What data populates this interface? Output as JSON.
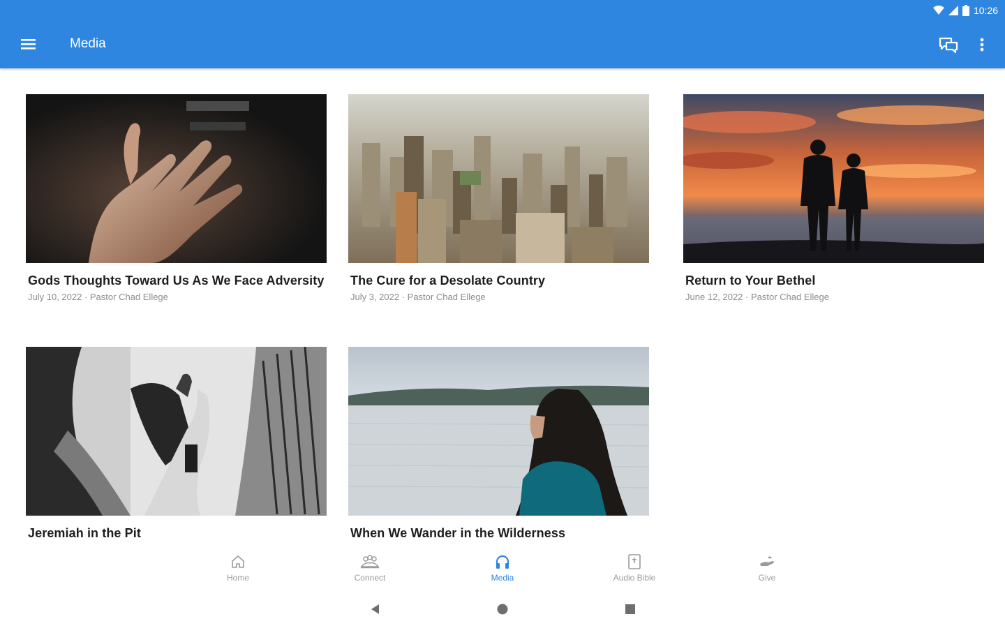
{
  "status": {
    "time": "10:26"
  },
  "appbar": {
    "title": "Media",
    "icons": {
      "menu": "menu-icon",
      "chat": "chat-icon",
      "more": "more-vert-icon"
    }
  },
  "colors": {
    "primary": "#2f86e0",
    "title_text": "#1d1d1d",
    "meta_text": "#8c8c8c"
  },
  "media": {
    "items": [
      {
        "title": "Gods Thoughts Toward Us As We Face Adversity",
        "meta": "July 10, 2022 · Pastor Chad Ellege",
        "image": "open-hand-photo"
      },
      {
        "title": "The Cure for a Desolate Country",
        "meta": "July 3, 2022 · Pastor Chad Ellege",
        "image": "city-skyline-photo"
      },
      {
        "title": "Return to Your Bethel",
        "meta": "June 12, 2022 · Pastor Chad Ellege",
        "image": "sunset-couple-photo"
      },
      {
        "title": "Jeremiah in the Pit",
        "meta": "",
        "image": "holding-hands-photo"
      },
      {
        "title": "When We Wander in the Wilderness",
        "meta": "",
        "image": "woman-by-lake-photo"
      }
    ]
  },
  "bottom_nav": {
    "items": [
      {
        "label": "Home",
        "icon": "home-icon",
        "active": false
      },
      {
        "label": "Connect",
        "icon": "people-icon",
        "active": false
      },
      {
        "label": "Media",
        "icon": "headphones-icon",
        "active": true
      },
      {
        "label": "Audio Bible",
        "icon": "bible-icon",
        "active": false
      },
      {
        "label": "Give",
        "icon": "giving-hand-icon",
        "active": false
      }
    ]
  },
  "system_nav": {
    "icons": [
      "back-icon",
      "home-circle-icon",
      "recents-icon"
    ]
  }
}
